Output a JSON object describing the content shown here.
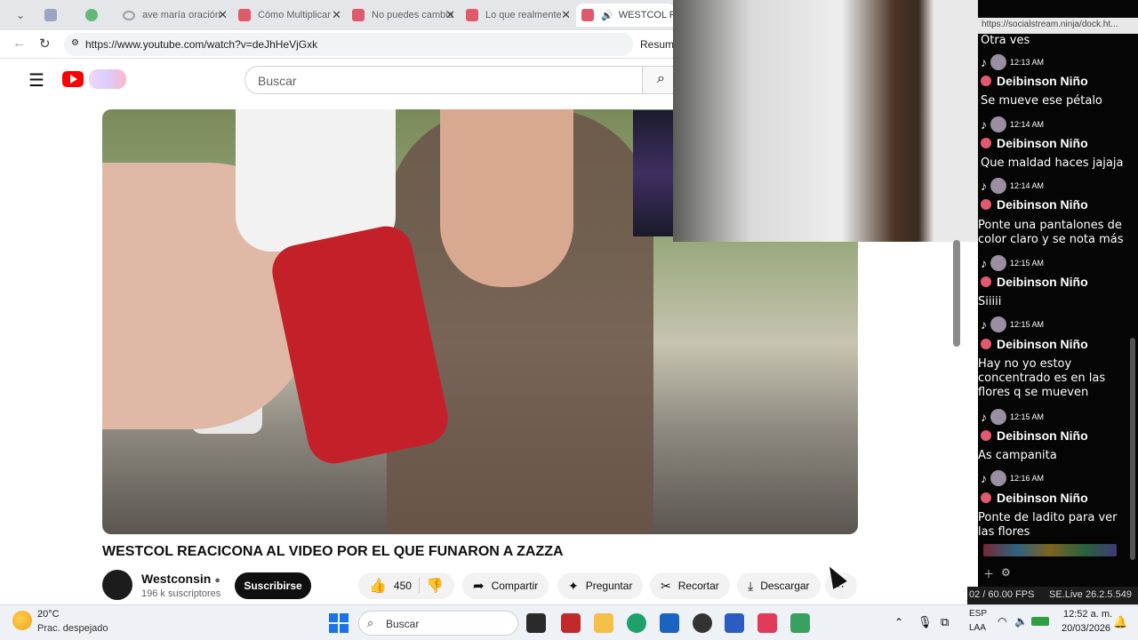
{
  "browser": {
    "tabs": [
      {
        "label": ""
      },
      {
        "label": ""
      },
      {
        "label": "ave maría oración"
      },
      {
        "label": "Cómo Multiplicar"
      },
      {
        "label": "No puedes cambia"
      },
      {
        "label": "Lo que realmente"
      },
      {
        "label": "WESTCOL REA"
      }
    ],
    "url": "https://www.youtube.com/watch?v=deJhHeVjGxk",
    "summary_label": "Resumi"
  },
  "youtube": {
    "search_placeholder": "Buscar",
    "video_title": "WESTCOL REACICONA AL VIDEO POR EL QUE FUNARON A ZAZZA",
    "channel_name": "Westconsin",
    "subscribers": "196 k suscriptores",
    "subscribe_label": "Suscribirse",
    "likes": "450",
    "share_label": "Compartir",
    "ask_label": "Preguntar",
    "clip_label": "Recortar",
    "download_label": "Descargar"
  },
  "dock": {
    "url": "https://socialstream.ninja/dock.ht...",
    "top_text": "Otra ves",
    "messages": [
      {
        "time": "12:13 AM",
        "name": "Deibinson Niño",
        "text": "Se mueve ese pétalo"
      },
      {
        "time": "12:14 AM",
        "name": "Deibinson Niño",
        "text": "Que maldad haces jajaja"
      },
      {
        "time": "12:14 AM",
        "name": "Deibinson Niño",
        "text": "Ponte una pantalones de color claro y se nota más"
      },
      {
        "time": "12:15 AM",
        "name": "Deibinson Niño",
        "text": "Siiiii"
      },
      {
        "time": "12:15 AM",
        "name": "Deibinson Niño",
        "text": "Hay no yo estoy concentrado es en las flores q se mueven"
      },
      {
        "time": "12:15 AM",
        "name": "Deibinson Niño",
        "text": "As campanita"
      },
      {
        "time": "12:16 AM",
        "name": "Deibinson Niño",
        "text": "Ponte de ladito para ver las flores"
      }
    ],
    "fps": "02 / 60.00 FPS",
    "version": "SE.Live 26.2.5.549"
  },
  "taskbar": {
    "temperature": "20°C",
    "weather": "Prac. despejado",
    "search_label": "Buscar",
    "lang_code": "ESP",
    "lang_region": "LAA",
    "time": "12:52 a. m.",
    "date": "20/03/2026"
  },
  "colors": {
    "youtube_red": "#ff0000",
    "tiktok_badge": "#e35a6e",
    "dock_bg": "#050505"
  }
}
